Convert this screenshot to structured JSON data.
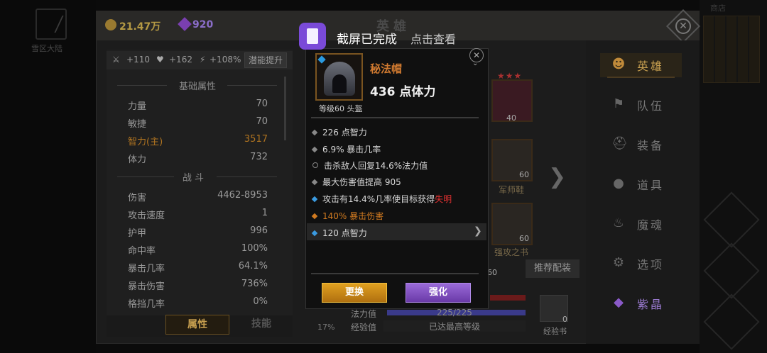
{
  "toast": {
    "title": "截屏已完成",
    "action": "点击查看"
  },
  "topbar": {
    "gold": "21.47万",
    "gems": "920",
    "title": "英雄"
  },
  "left_edge": {
    "label": "雪区大陆"
  },
  "right_edge": {
    "label": "商店"
  },
  "bonuses": {
    "attack": "+110",
    "health": "+162",
    "speed": "+108%",
    "potential_label": "潜能提升"
  },
  "stats": {
    "basic_title": "基础属性",
    "basic": [
      {
        "name": "力量",
        "value": "70"
      },
      {
        "name": "敏捷",
        "value": "70"
      },
      {
        "name": "智力(主)",
        "value": "3517"
      },
      {
        "name": "体力",
        "value": "732"
      }
    ],
    "combat_title": "战 斗",
    "combat": [
      {
        "name": "伤害",
        "value": "4462-8953"
      },
      {
        "name": "攻击速度",
        "value": "1"
      },
      {
        "name": "护甲",
        "value": "996"
      },
      {
        "name": "命中率",
        "value": "100%"
      },
      {
        "name": "暴击几率",
        "value": "64.1%"
      },
      {
        "name": "暴击伤害",
        "value": "736%"
      },
      {
        "name": "格挡几率",
        "value": "0%"
      }
    ],
    "tab_attr": "属性",
    "tab_skill": "技能"
  },
  "equip": {
    "stars": "★★★",
    "slot_top_level": "40",
    "boots_level": "60",
    "boots_label": "军师鞋",
    "book_level": "60",
    "book_label": "强攻之书",
    "recommend": "推荐配装",
    "other_level": "60"
  },
  "bars": {
    "mana_label": "法力值",
    "mana_value": "225/225",
    "xp_label": "经验值",
    "xp_value": "已达最高等级",
    "pct": "17%",
    "xp_book": "经验书",
    "xp_book_count": "0"
  },
  "item": {
    "name": "秘法帽",
    "main_stat": "436 点体力",
    "subtitle": "等级60 头盔",
    "affixes": [
      {
        "text": "226 点智力"
      },
      {
        "text": "6.9% 暴击几率"
      },
      {
        "text": "击杀敌人回复14.6%法力值"
      },
      {
        "text": "最大伤害值提高 905"
      },
      {
        "text": "攻击有14.4%几率使目标获得",
        "suffix": "失明"
      },
      {
        "text": "140% 暴击伤害"
      },
      {
        "text": "120 点智力"
      }
    ],
    "replace": "更换",
    "upgrade": "强化"
  },
  "nav": [
    {
      "label": "英雄"
    },
    {
      "label": "队伍"
    },
    {
      "label": "装备"
    },
    {
      "label": "道具"
    },
    {
      "label": "魔魂"
    },
    {
      "label": "选项"
    },
    {
      "label": "紫晶"
    }
  ],
  "icons": [
    "sword-icon",
    "heart-icon",
    "lightning-icon",
    "person-icon",
    "flag-icon",
    "helmet-icon",
    "bag-icon",
    "flame-icon",
    "gear-icon",
    "crystal-icon",
    "close-icon",
    "chevron-right-icon"
  ],
  "colors": {
    "gold": "#b59a44",
    "accent": "#c8a050",
    "orange": "#d07a30",
    "purple": "#8a5ac8",
    "red": "#e03030"
  }
}
